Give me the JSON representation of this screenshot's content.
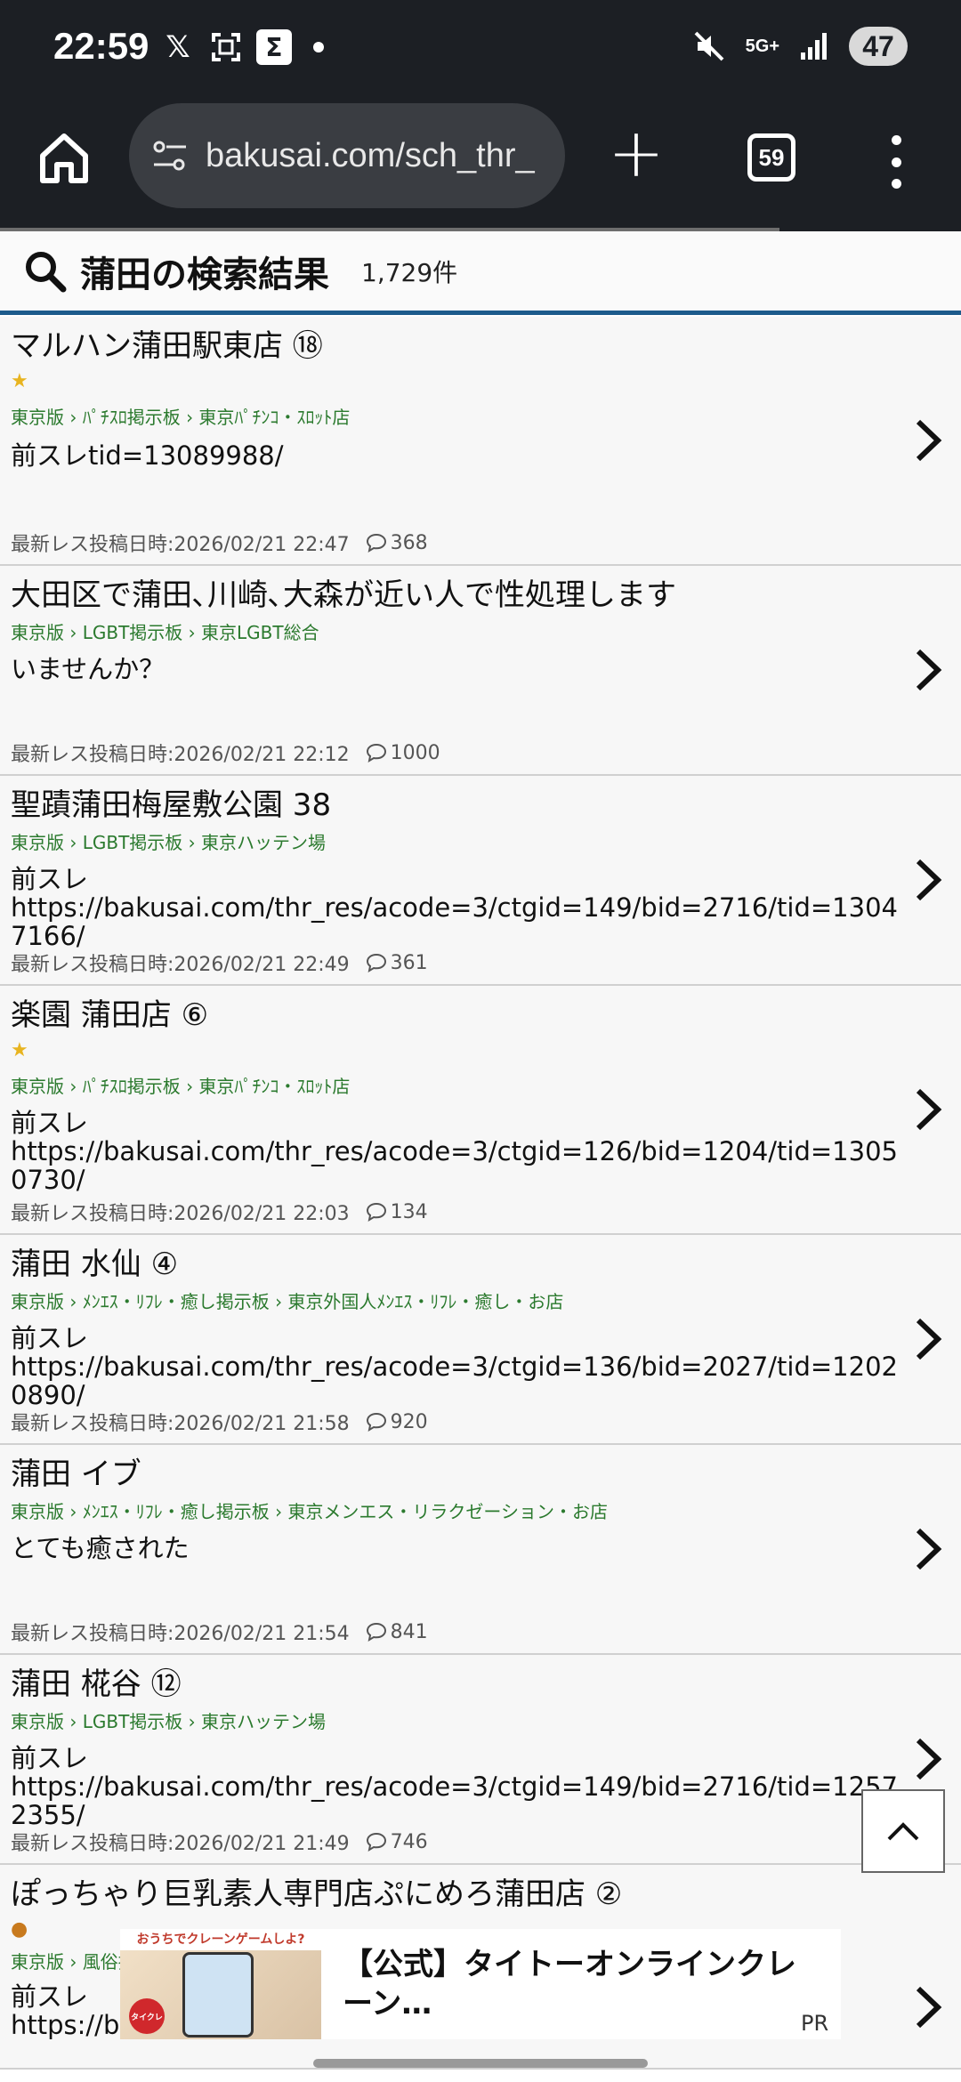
{
  "status_bar": {
    "time": "22:59",
    "battery": "47",
    "network": "5G+"
  },
  "browser": {
    "url": "bakusai.com/sch_thr_",
    "tab_count": "59"
  },
  "search": {
    "title": "蒲田の検索結果",
    "count": "1,729件"
  },
  "threads": [
    {
      "title": "マルハン蒲田駅東店 ⑱",
      "badge": "★",
      "breadcrumb": "東京版 › ﾊﾟﾁｽﾛ掲示板 › 東京ﾊﾟﾁﾝｺ・ｽﾛｯﾄ店",
      "body": "前スレtid=13089988/",
      "date": "最新レス投稿日時:2026/02/21 22:47",
      "comments": "368"
    },
    {
      "title": "大田区で蒲田､川崎､大森が近い人で性処理します",
      "badge": "",
      "breadcrumb": "東京版 › LGBT掲示板 › 東京LGBT総合",
      "body": "いませんか？",
      "date": "最新レス投稿日時:2026/02/21 22:12",
      "comments": "1000"
    },
    {
      "title": "聖蹟蒲田梅屋敷公園 38",
      "badge": "",
      "breadcrumb": "東京版 › LGBT掲示板 › 東京ハッテン場",
      "body": "前スレ\nhttps://bakusai.com/thr_res/acode=3/ctgid=149/bid=2716/tid=13047166/",
      "date": "最新レス投稿日時:2026/02/21 22:49",
      "comments": "361"
    },
    {
      "title": "楽園 蒲田店 ⑥",
      "badge": "★",
      "breadcrumb": "東京版 › ﾊﾟﾁｽﾛ掲示板 › 東京ﾊﾟﾁﾝｺ・ｽﾛｯﾄ店",
      "body": "前スレ\nhttps://bakusai.com/thr_res/acode=3/ctgid=126/bid=1204/tid=13050730/",
      "date": "最新レス投稿日時:2026/02/21 22:03",
      "comments": "134"
    },
    {
      "title": "蒲田 水仙 ④",
      "badge": "",
      "breadcrumb": "東京版 › ﾒﾝｴｽ・ﾘﾌﾚ・癒し掲示板 › 東京外国人ﾒﾝｴｽ・ﾘﾌﾚ・癒し・お店",
      "body": "前スレ\nhttps://bakusai.com/thr_res/acode=3/ctgid=136/bid=2027/tid=12020890/",
      "date": "最新レス投稿日時:2026/02/21 21:58",
      "comments": "920"
    },
    {
      "title": "蒲田 イブ",
      "badge": "",
      "breadcrumb": "東京版 › ﾒﾝｴｽ・ﾘﾌﾚ・癒し掲示板 › 東京メンエス・リラクゼーション・お店",
      "body": "とても癒された",
      "date": "最新レス投稿日時:2026/02/21 21:54",
      "comments": "841"
    },
    {
      "title": "蒲田 椛谷 ⑫",
      "badge": "",
      "breadcrumb": "東京版 › LGBT掲示板 › 東京ハッテン場",
      "body": "前スレ\nhttps://bakusai.com/thr_res/acode=3/ctgid=149/bid=2716/tid=12572355/",
      "date": "最新レス投稿日時:2026/02/21 21:49",
      "comments": "746"
    },
    {
      "title": "ぽっちゃり巨乳素人専門店ぷにめろ蒲田店 ②",
      "badge": "●",
      "breadcrumb": "東京版 › 風俗掲",
      "body": "前スレ\nhttps://ba                                                                           588/",
      "date": "",
      "comments": ""
    }
  ],
  "ad": {
    "banner": "おうちでクレーンゲームしよ?",
    "logo": "タイクレ",
    "text": "【公式】タイトーオンラインクレーン…",
    "pr": "PR"
  }
}
